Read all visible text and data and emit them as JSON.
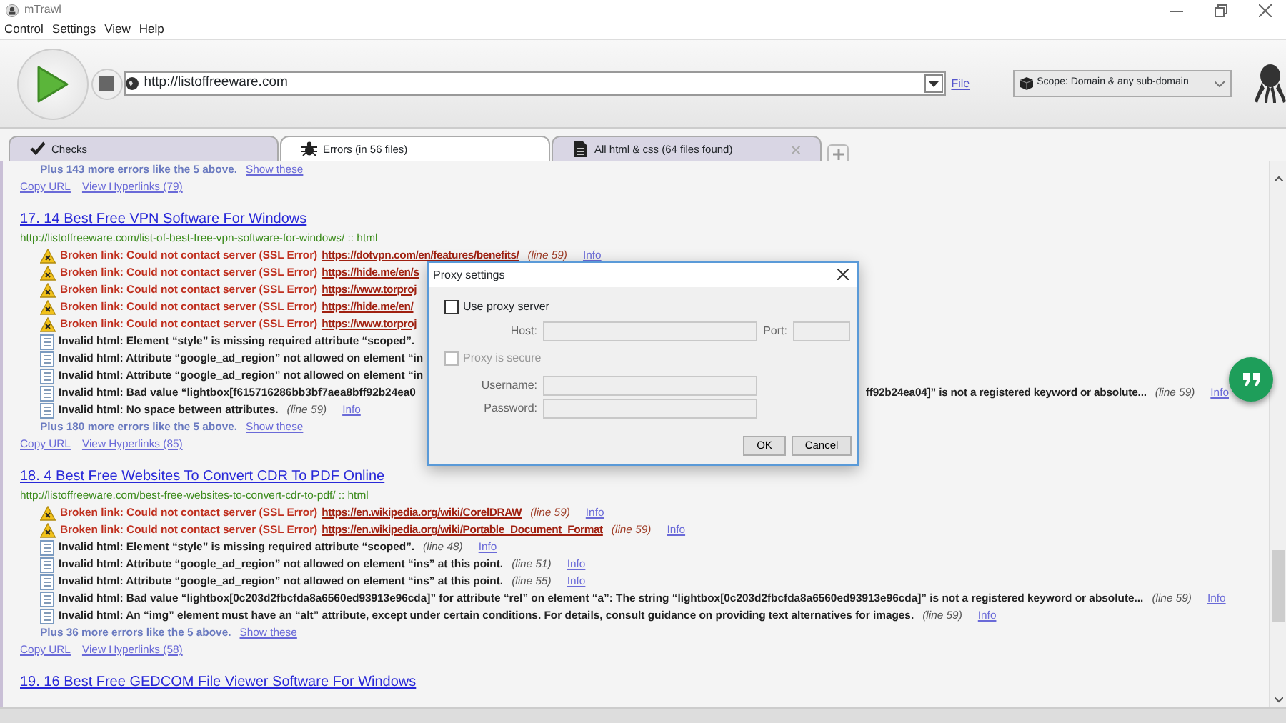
{
  "window": {
    "title": "mTrawl"
  },
  "menu": [
    "Control",
    "Settings",
    "View",
    "Help"
  ],
  "toolbar": {
    "url": "http://listoffreeware.com",
    "file_link": "File",
    "scope": "Scope: Domain & any sub-domain"
  },
  "tabs": [
    {
      "label": "Checks",
      "selected": false,
      "closable": false,
      "kind": "check"
    },
    {
      "label": "Errors (in 56 files)",
      "selected": true,
      "closable": false,
      "kind": "bug"
    },
    {
      "label": "All html & css (64 files found)",
      "selected": false,
      "closable": true,
      "kind": "doc"
    }
  ],
  "results": {
    "top_summary": {
      "text": "Plus 143 more errors like the 5 above.",
      "link": "Show these"
    },
    "top_links": [
      "Copy URL",
      "View Hyperlinks (79)"
    ],
    "pages": [
      {
        "title": "17. 14 Best Free VPN Software For Windows",
        "url": "http://listoffreeware.com/list-of-best-free-vpn-software-for-windows/ :: html",
        "items": [
          {
            "kind": "broken",
            "message": "Broken link: Could not contact server (SSL Error)",
            "link": "https://dotvpn.com/en/features/benefits/",
            "line": "(line 59)",
            "info": "Info"
          },
          {
            "kind": "broken",
            "message": "Broken link: Could not contact server (SSL Error)",
            "link": "https://hide.me/en/s"
          },
          {
            "kind": "broken",
            "message": "Broken link: Could not contact server (SSL Error)",
            "link": "https://www.torproj"
          },
          {
            "kind": "broken",
            "message": "Broken link: Could not contact server (SSL Error)",
            "link": "https://hide.me/en/"
          },
          {
            "kind": "broken",
            "message": "Broken link: Could not contact server (SSL Error)",
            "link": "https://www.torproj"
          },
          {
            "kind": "invalid",
            "message": "Invalid html: Element “style” is missing required attribute “scoped”."
          },
          {
            "kind": "invalid",
            "message": "Invalid html: Attribute “google_ad_region” not allowed on element “in"
          },
          {
            "kind": "invalid",
            "message": "Invalid html: Attribute “google_ad_region” not allowed on element “in"
          },
          {
            "kind": "invalid",
            "message": "Invalid html: Bad value “lightbox[f615716286bb3bf7aea8bff92b24ea0",
            "message_after": "ff92b24ea04]” is not a registered keyword or absolute...",
            "line": "(line 59)",
            "info": "Info"
          },
          {
            "kind": "invalid",
            "message": "Invalid html: No space between attributes.",
            "line": "(line 59)",
            "info": "Info"
          }
        ],
        "summary": {
          "text": "Plus 180 more errors like the 5 above.",
          "link": "Show these"
        },
        "links": [
          "Copy URL",
          "View Hyperlinks (85)"
        ]
      },
      {
        "title": "18. 4 Best Free Websites To Convert CDR To PDF Online",
        "url": "http://listoffreeware.com/best-free-websites-to-convert-cdr-to-pdf/ :: html",
        "items": [
          {
            "kind": "broken",
            "message": "Broken link: Could not contact server (SSL Error)",
            "link": "https://en.wikipedia.org/wiki/CorelDRAW",
            "line": "(line 59)",
            "info": "Info"
          },
          {
            "kind": "broken",
            "message": "Broken link: Could not contact server (SSL Error)",
            "link": "https://en.wikipedia.org/wiki/Portable_Document_Format",
            "line": "(line 59)",
            "info": "Info"
          },
          {
            "kind": "invalid",
            "message": "Invalid html: Element “style” is missing required attribute “scoped”.",
            "line": "(line 48)",
            "info": "Info"
          },
          {
            "kind": "invalid",
            "message": "Invalid html: Attribute “google_ad_region” not allowed on element “ins” at this point.",
            "line": "(line 51)",
            "info": "Info"
          },
          {
            "kind": "invalid",
            "message": "Invalid html: Attribute “google_ad_region” not allowed on element “ins” at this point.",
            "line": "(line 55)",
            "info": "Info"
          },
          {
            "kind": "invalid",
            "message": "Invalid html: Bad value “lightbox[0c203d2fbcfda8a6560ed93913e96cda]” for attribute “rel” on element “a”: The string “lightbox[0c203d2fbcfda8a6560ed93913e96cda]” is not a registered keyword or absolute...",
            "line": "(line 59)",
            "info": "Info"
          },
          {
            "kind": "invalid",
            "message": "Invalid html: An “img” element must have an “alt” attribute, except under certain conditions. For details, consult guidance on providing text alternatives for images.",
            "line": "(line 59)",
            "info": "Info"
          }
        ],
        "summary": {
          "text": "Plus 36 more errors like the 5 above.",
          "link": "Show these"
        },
        "links": [
          "Copy URL",
          "View Hyperlinks (58)"
        ]
      },
      {
        "title": "19. 16 Best Free GEDCOM File Viewer Software For Windows"
      }
    ]
  },
  "dialog": {
    "title": "Proxy settings",
    "use_proxy": {
      "label": "Use proxy server",
      "checked": false,
      "disabled": false
    },
    "host": {
      "label": "Host:",
      "disabled": true
    },
    "port": {
      "label": "Port:",
      "disabled": true
    },
    "secure": {
      "label": "Proxy is secure",
      "checked": false,
      "disabled": true
    },
    "username": {
      "label": "Username:",
      "disabled": true
    },
    "password": {
      "label": "Password:",
      "disabled": true
    },
    "buttons": [
      "OK",
      "Cancel"
    ]
  }
}
